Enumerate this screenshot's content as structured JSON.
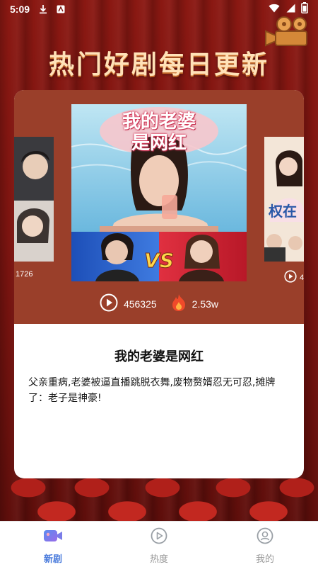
{
  "status_bar": {
    "time": "5:09"
  },
  "header": {
    "headline": "热门好剧每日更新"
  },
  "carousel": {
    "left_partial": {
      "play_count": "1726"
    },
    "right_partial": {
      "play_count": "4"
    },
    "current": {
      "poster_title_art": "我的老婆是网红",
      "plays": "456325",
      "heat": "2.53w",
      "title": "我的老婆是网红",
      "description": "父亲重病,老婆被逼直播跳脱衣舞,废物赘婿忍无可忍,摊牌了：老子是神豪!"
    }
  },
  "bottom_nav": {
    "items": [
      {
        "label": "新剧",
        "icon": "video-camera-icon",
        "active": true
      },
      {
        "label": "热度",
        "icon": "play-circle-icon",
        "active": false
      },
      {
        "label": "我的",
        "icon": "user-circle-icon",
        "active": false
      }
    ]
  },
  "colors": {
    "accent": "#4a7bdc",
    "card_top": "#9a3f2a",
    "background": "#7c1410"
  }
}
